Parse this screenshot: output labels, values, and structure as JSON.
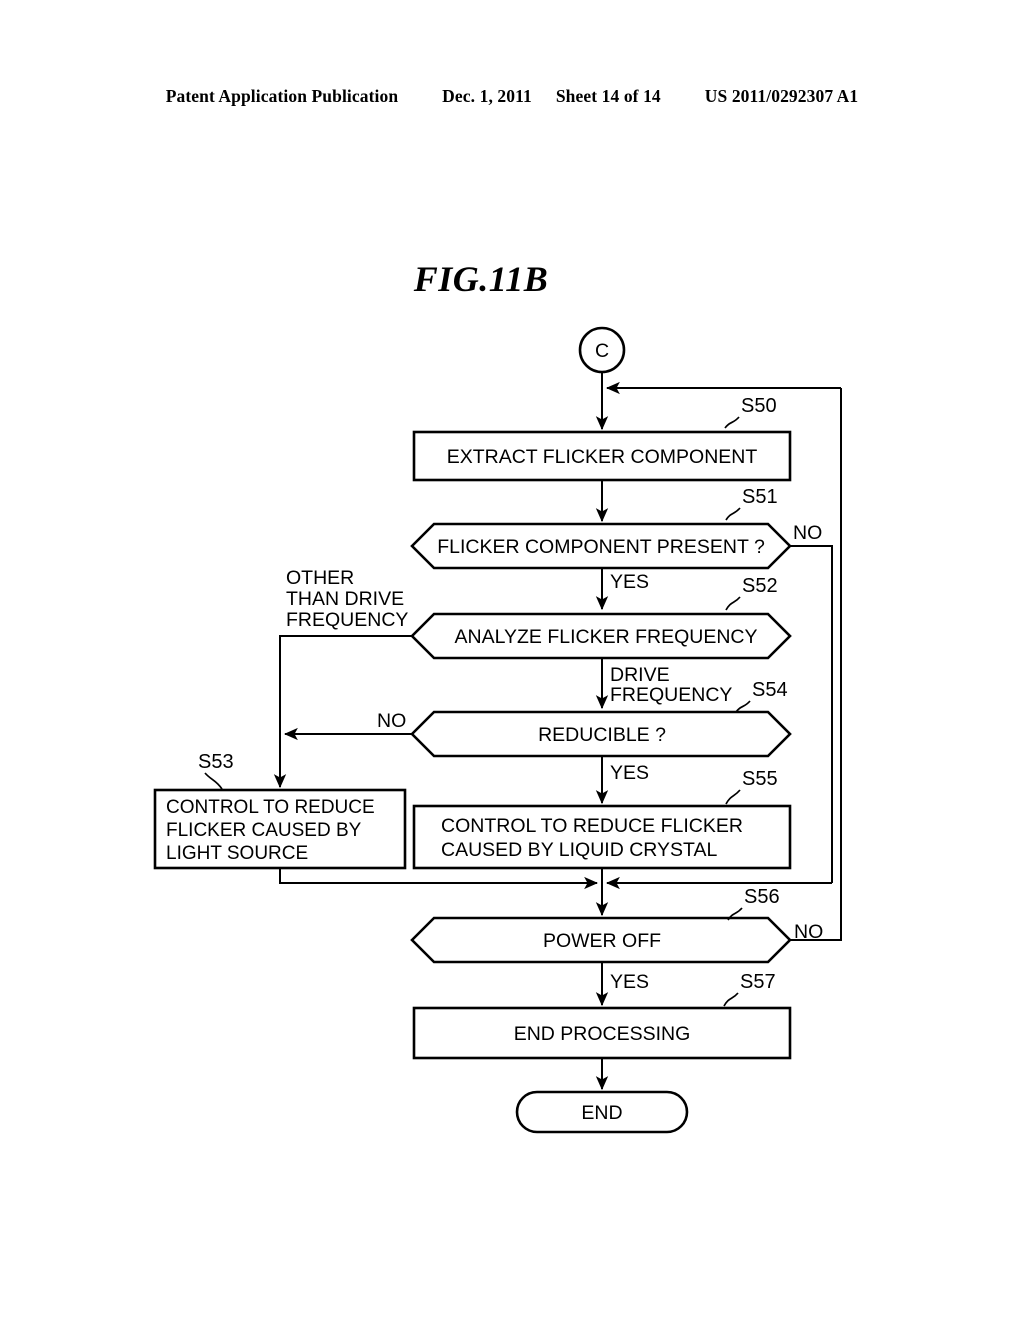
{
  "header": {
    "publication": "Patent Application Publication",
    "date": "Dec. 1, 2011",
    "sheet": "Sheet 14 of 14",
    "patent_number": "US 2011/0292307 A1"
  },
  "figure": {
    "title": "FIG.11B"
  },
  "flowchart": {
    "connector_in": "C",
    "terminator_end": "END",
    "nodes": [
      {
        "id": "S50",
        "label": "S50",
        "text": "EXTRACT FLICKER COMPONENT",
        "shape": "process"
      },
      {
        "id": "S51",
        "label": "S51",
        "text": "FLICKER COMPONENT PRESENT ?",
        "shape": "decision"
      },
      {
        "id": "S52",
        "label": "S52",
        "text": "ANALYZE FLICKER FREQUENCY",
        "shape": "decision"
      },
      {
        "id": "S54",
        "label": "S54",
        "text": "REDUCIBLE ?",
        "shape": "decision"
      },
      {
        "id": "S53",
        "label": "S53",
        "text_lines": [
          "CONTROL TO REDUCE",
          "FLICKER CAUSED BY",
          "LIGHT SOURCE"
        ],
        "shape": "process"
      },
      {
        "id": "S55",
        "label": "S55",
        "text_lines": [
          "CONTROL TO REDUCE FLICKER",
          "CAUSED BY LIQUID CRYSTAL"
        ],
        "shape": "process"
      },
      {
        "id": "S56",
        "label": "S56",
        "text": "POWER OFF",
        "shape": "decision"
      },
      {
        "id": "S57",
        "label": "S57",
        "text": "END PROCESSING",
        "shape": "process"
      }
    ],
    "edge_labels": {
      "s51_no": "NO",
      "s51_yes": "YES",
      "s52_other": [
        "OTHER",
        "THAN DRIVE",
        "FREQUENCY"
      ],
      "s52_drive": [
        "DRIVE",
        "FREQUENCY"
      ],
      "s54_no": "NO",
      "s54_yes": "YES",
      "s56_no": "NO",
      "s56_yes": "YES"
    }
  },
  "colors": {
    "ink": "#000000",
    "paper": "#ffffff"
  }
}
